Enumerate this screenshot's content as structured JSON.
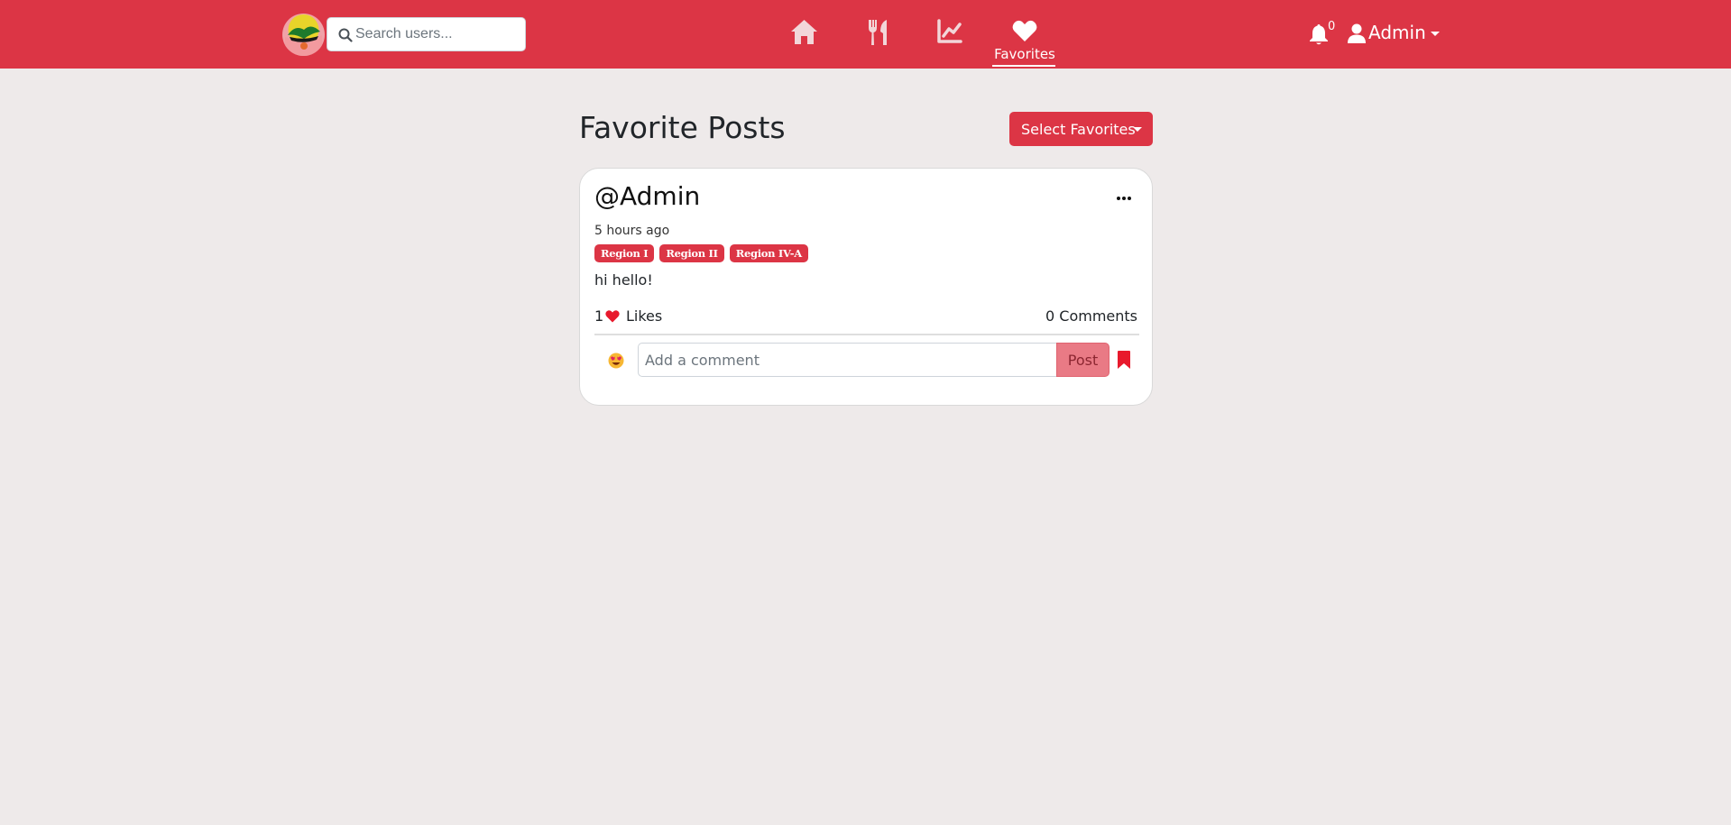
{
  "navbar": {
    "search_placeholder": "Search users...",
    "nav_items": [
      {
        "name": "home",
        "icon": "home-icon"
      },
      {
        "name": "food",
        "icon": "fork-knife-icon"
      },
      {
        "name": "stats",
        "icon": "chart-line-icon"
      },
      {
        "name": "favorites",
        "icon": "heart-icon",
        "label": "Favorites",
        "active": true
      }
    ],
    "notification_count": "0",
    "user_name": "Admin"
  },
  "page": {
    "title": "Favorite Posts",
    "select_button_label": "Select Favorites"
  },
  "post": {
    "author": "@Admin",
    "time": "5 hours ago",
    "tags": [
      "Region I",
      "Region II",
      "Region IV-A"
    ],
    "content": "hi hello!",
    "likes_count": "1",
    "likes_label": "Likes",
    "comments_label": "0 Comments",
    "comment_placeholder": "Add a comment",
    "post_button_label": "Post"
  },
  "colors": {
    "brand": "#dc3545",
    "background": "#eeeaea",
    "post_button": "#e97a85",
    "bookmark": "#e8192c"
  }
}
